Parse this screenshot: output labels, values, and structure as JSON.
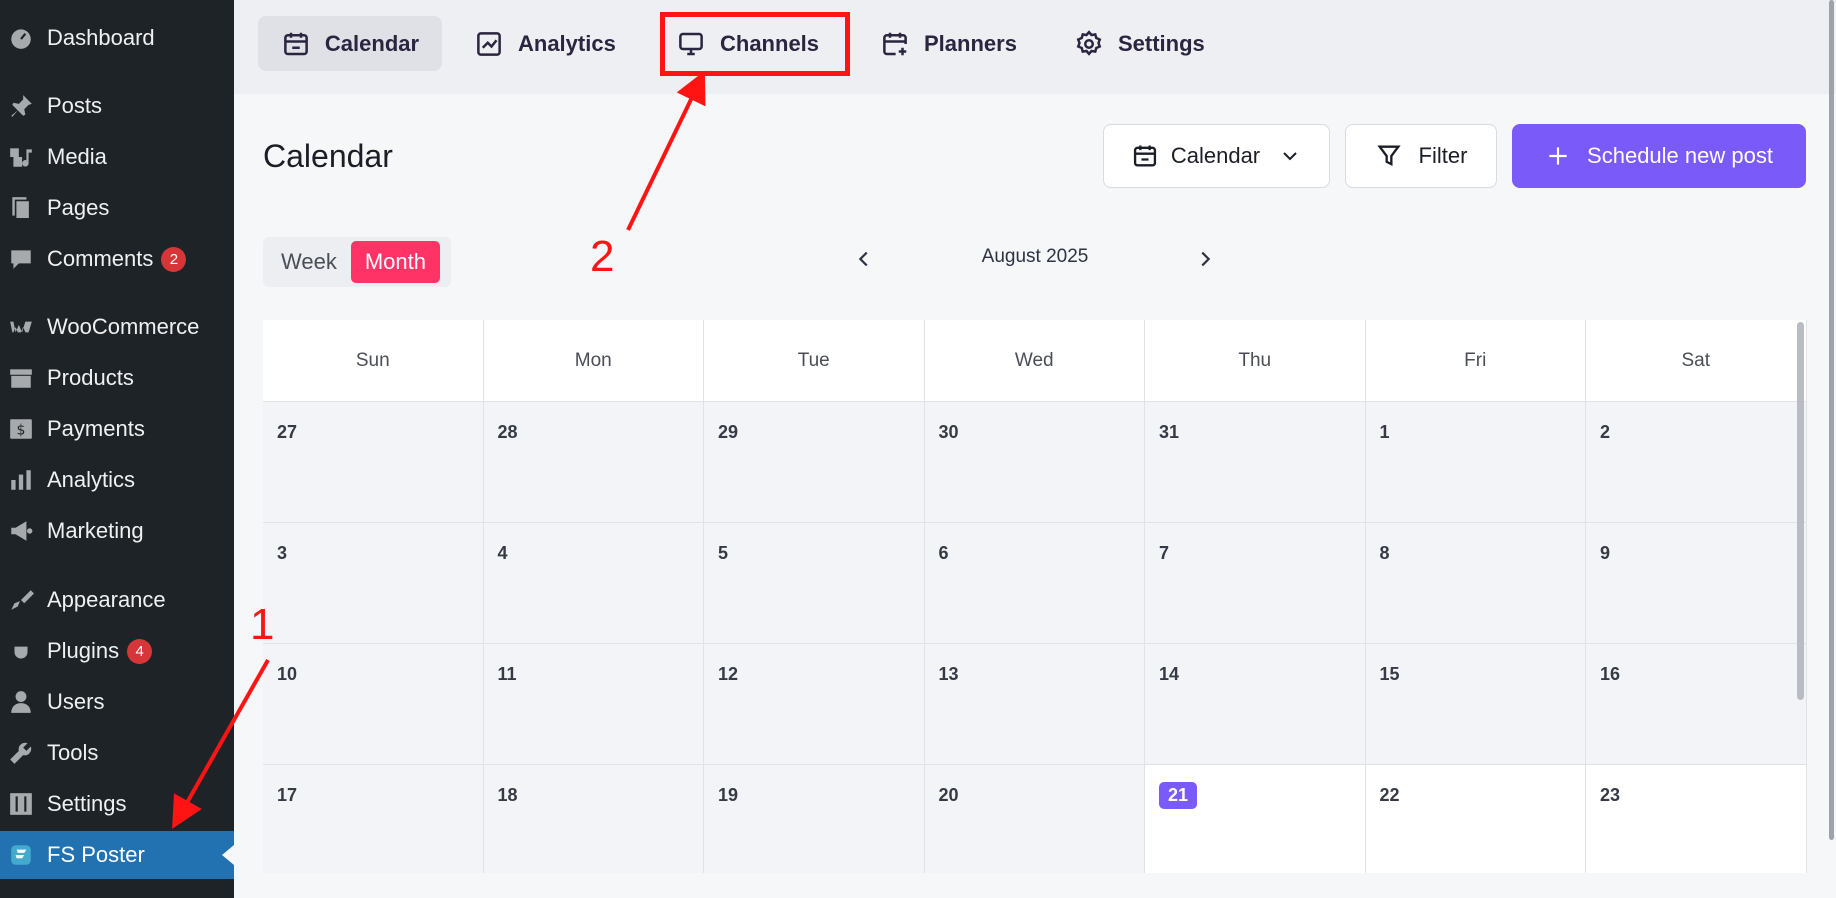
{
  "sidebar": {
    "items": [
      {
        "label": "Dashboard",
        "icon": "dashboard-icon",
        "badge": ""
      },
      {
        "label": "Posts",
        "icon": "pin-icon",
        "badge": ""
      },
      {
        "label": "Media",
        "icon": "media-icon",
        "badge": ""
      },
      {
        "label": "Pages",
        "icon": "pages-icon",
        "badge": ""
      },
      {
        "label": "Comments",
        "icon": "comment-icon",
        "badge": "2"
      },
      {
        "label": "WooCommerce",
        "icon": "woo-icon",
        "badge": ""
      },
      {
        "label": "Products",
        "icon": "archive-icon",
        "badge": ""
      },
      {
        "label": "Payments",
        "icon": "dollar-icon",
        "badge": ""
      },
      {
        "label": "Analytics",
        "icon": "bar-chart-icon",
        "badge": ""
      },
      {
        "label": "Marketing",
        "icon": "megaphone-icon",
        "badge": ""
      },
      {
        "label": "Appearance",
        "icon": "brush-icon",
        "badge": ""
      },
      {
        "label": "Plugins",
        "icon": "plugin-icon",
        "badge": "4"
      },
      {
        "label": "Users",
        "icon": "user-icon",
        "badge": ""
      },
      {
        "label": "Tools",
        "icon": "wrench-icon",
        "badge": ""
      },
      {
        "label": "Settings",
        "icon": "sliders-icon",
        "badge": ""
      },
      {
        "label": "FS Poster",
        "icon": "fs-poster-icon",
        "badge": ""
      }
    ],
    "active": "FS Poster"
  },
  "tabs": [
    {
      "label": "Calendar",
      "icon": "calendar-icon"
    },
    {
      "label": "Analytics",
      "icon": "trend-icon"
    },
    {
      "label": "Channels",
      "icon": "monitor-icon"
    },
    {
      "label": "Planners",
      "icon": "calendar-plus-icon"
    },
    {
      "label": "Settings",
      "icon": "gear-icon"
    }
  ],
  "active_tab": "Calendar",
  "main": {
    "title": "Calendar",
    "view_dropdown": "Calendar",
    "filter_label": "Filter",
    "schedule_label": "Schedule new post",
    "week_label": "Week",
    "month_label": "Month",
    "current_month": "August 2025"
  },
  "calendar": {
    "days": [
      "Sun",
      "Mon",
      "Tue",
      "Wed",
      "Thu",
      "Fri",
      "Sat"
    ],
    "weeks": [
      [
        "27",
        "28",
        "29",
        "30",
        "31",
        "1",
        "2"
      ],
      [
        "3",
        "4",
        "5",
        "6",
        "7",
        "8",
        "9"
      ],
      [
        "10",
        "11",
        "12",
        "13",
        "14",
        "15",
        "16"
      ],
      [
        "17",
        "18",
        "19",
        "20",
        "21",
        "22",
        "23"
      ]
    ],
    "today": "21"
  },
  "annotations": {
    "step1": "1",
    "step2": "2"
  },
  "colors": {
    "accent": "#7a5af8",
    "month_toggle": "#ff3366",
    "annotation": "#ff1414",
    "wp_active": "#2271b1"
  }
}
